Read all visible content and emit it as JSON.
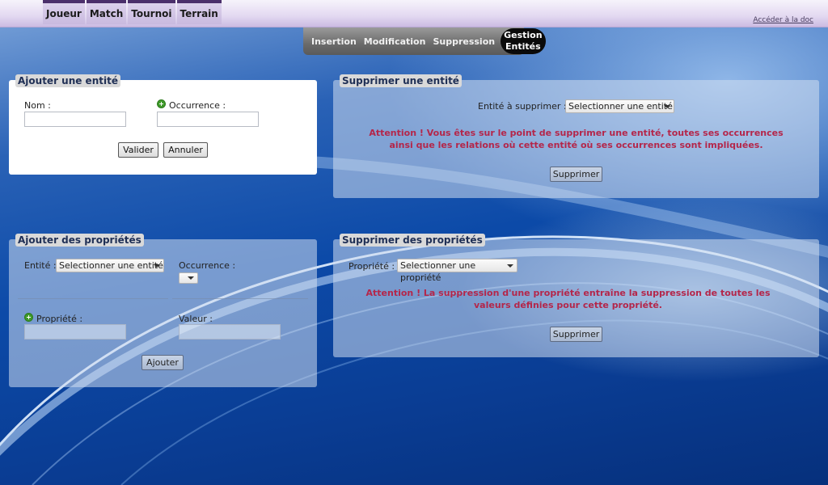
{
  "nav": {
    "items": [
      {
        "label": "Joueur"
      },
      {
        "label": "Match"
      },
      {
        "label": "Tournoi"
      },
      {
        "label": "Terrain"
      }
    ],
    "doc_link": "Accéder à la doc"
  },
  "submenu": {
    "items": [
      {
        "label": "Insertion"
      },
      {
        "label": "Modification"
      },
      {
        "label": "Suppression"
      }
    ],
    "active_line1": "Gestion",
    "active_line2": "Entités"
  },
  "add_entity": {
    "title": "Ajouter une entité",
    "name_label": "Nom :",
    "name_value": "",
    "occurrence_label": "Occurrence :",
    "occurrence_value": "",
    "validate_label": "Valider",
    "cancel_label": "Annuler"
  },
  "delete_entity": {
    "title": "Supprimer une entité",
    "select_label": "Entité à supprimer :",
    "select_value": "Selectionner une entité",
    "warning": "Attention ! Vous êtes sur le point de supprimer une entité, toutes ses occurrences ainsi que les relations où cette entité où ses occurrences sont impliquées.",
    "delete_label": "Supprimer"
  },
  "add_properties": {
    "title": "Ajouter des propriétés",
    "entity_label": "Entité :",
    "entity_value": "Selectionner une entité",
    "occurrence_label": "Occurrence :",
    "property_label": "Propriété :",
    "property_value": "",
    "value_label": "Valeur :",
    "value_value": "",
    "add_label": "Ajouter"
  },
  "delete_properties": {
    "title": "Supprimer des propriétés",
    "property_label": "Propriété :",
    "property_value": "Selectionner une propriété",
    "warning": "Attention ! La suppression d'une propriété entraîne la suppression de toutes les valeurs définies pour cette propriété.",
    "delete_label": "Supprimer"
  },
  "colors": {
    "warning": "#b4264a",
    "nav_accent": "#4b2f6b",
    "add_icon": "#3f9a2a"
  }
}
